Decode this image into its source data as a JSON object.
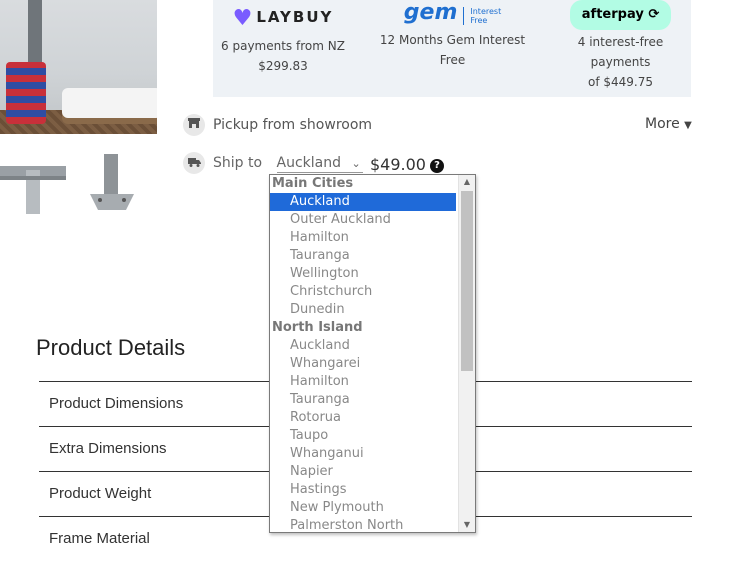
{
  "payments": {
    "laybuy": {
      "logo": "LAYBUY",
      "line1": "6 payments from NZ",
      "line2": "$299.83"
    },
    "gem": {
      "logo": "gem",
      "tag1": "Interest",
      "tag2": "Free",
      "line1": "12 Months Gem Interest",
      "line2": "Free"
    },
    "afterpay": {
      "logo": "afterpay",
      "line1": "4 interest-free payments",
      "line2": "of $449.75"
    }
  },
  "delivery": {
    "pickup_label": "Pickup from showroom",
    "more_label": "More",
    "ship_label": "Ship to",
    "ship_value": "Auckland",
    "price": "$49.00"
  },
  "product_details": {
    "title": "Product Details",
    "rows": [
      "Product Dimensions",
      "Extra Dimensions",
      "Product Weight",
      "Frame Material"
    ]
  },
  "dropdown": {
    "groups": [
      {
        "label": "Main Cities",
        "options": [
          "Auckland",
          "Outer Auckland",
          "Hamilton",
          "Tauranga",
          "Wellington",
          "Christchurch",
          "Dunedin"
        ]
      },
      {
        "label": "North Island",
        "options": [
          "Auckland",
          "Whangarei",
          "Hamilton",
          "Tauranga",
          "Rotorua",
          "Taupo",
          "Whanganui",
          "Napier",
          "Hastings",
          "New Plymouth",
          "Palmerston North"
        ]
      }
    ],
    "selected": "Auckland"
  },
  "colors": {
    "accent_selection": "#1f6ad9",
    "panel_bg": "#eef2f6",
    "laybuy": "#7a5cff",
    "gem": "#1f6fd0",
    "afterpay": "#b2fce4"
  },
  "icons": {
    "pickup": "store-icon",
    "ship": "truck-icon",
    "more": "caret-down-icon",
    "help": "question-circle-icon",
    "select": "chevron-down-icon"
  }
}
